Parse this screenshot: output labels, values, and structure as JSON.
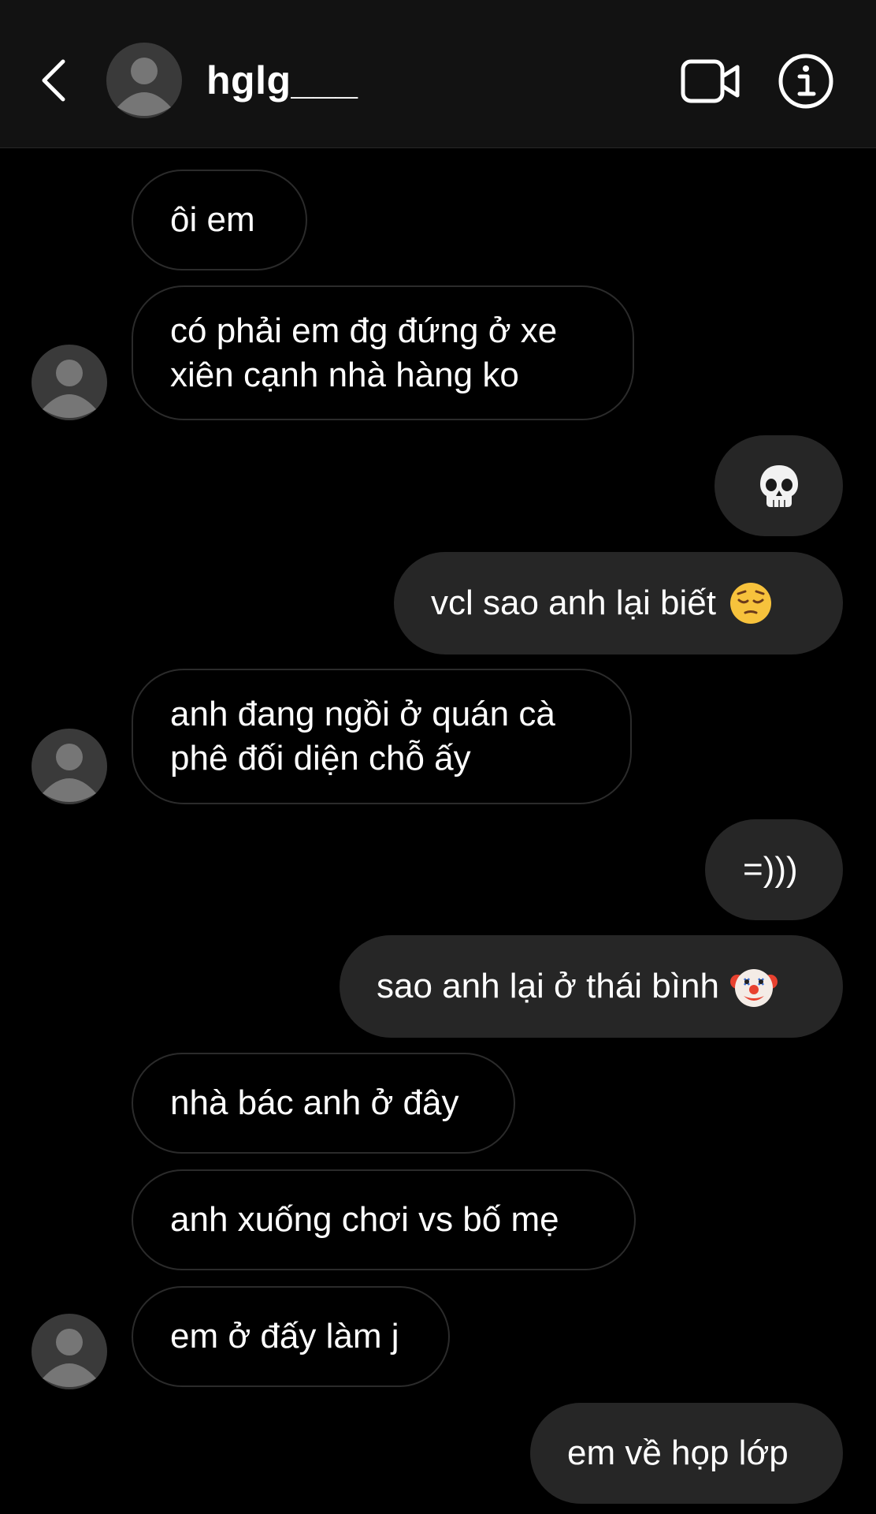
{
  "header": {
    "username": "hglg___",
    "back_icon": "chevron-left-icon",
    "video_icon": "video-camera-icon",
    "info_icon": "info-circle-icon"
  },
  "colors": {
    "background": "#000000",
    "header_background": "#121212",
    "sent_bubble": "#262626",
    "received_border": "#2b2b2b",
    "avatar_background": "#3a3a3a",
    "avatar_silhouette": "#767676"
  },
  "messages": [
    {
      "side": "received",
      "lines": [
        "ôi em"
      ]
    },
    {
      "side": "received",
      "lines": [
        "có phải em đg đứng ở xe",
        "xiên cạnh nhà hàng ko"
      ]
    },
    {
      "side": "sent",
      "emoji": "skull-emoji"
    },
    {
      "side": "sent",
      "lines": [
        "vcl sao anh lại biết"
      ],
      "emoji": "pensive-face-emoji"
    },
    {
      "side": "received",
      "lines": [
        "anh đang ngồi ở quán cà",
        "phê đối diện chỗ ấy"
      ]
    },
    {
      "side": "sent",
      "lines": [
        "=)))"
      ]
    },
    {
      "side": "sent",
      "lines": [
        "sao anh lại ở thái bình"
      ],
      "emoji": "clown-face-emoji"
    },
    {
      "side": "received",
      "lines": [
        "nhà bác anh ở đây"
      ]
    },
    {
      "side": "received",
      "lines": [
        "anh xuống chơi vs bố mẹ"
      ]
    },
    {
      "side": "received",
      "lines": [
        "em ở đấy làm j"
      ]
    },
    {
      "side": "sent",
      "lines": [
        "em về họp lớp"
      ]
    }
  ]
}
